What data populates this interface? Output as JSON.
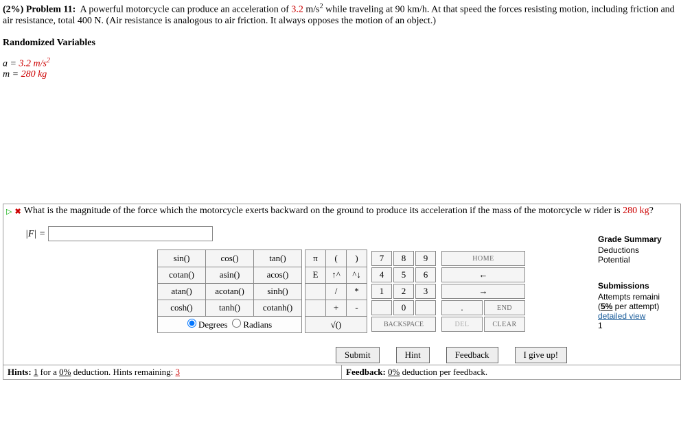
{
  "problem": {
    "weight_label": "(2%) Problem 11:",
    "text_before_a": "A powerful motorcycle can produce an acceleration of ",
    "a_value": "3.2",
    "a_unit": " m/s",
    "text_after_a": " while traveling at 90 km/h. At that speed the forces resisting motion, including friction and air resistance, total 400 N. (Air resistance is analogous to air friction. It always opposes the motion of an object.)"
  },
  "rand_vars": {
    "title": "Randomized Variables",
    "a_label": "a = ",
    "a_value": "3.2 m/s",
    "m_label": "m = ",
    "m_value": "280 kg"
  },
  "question": {
    "text_before": "What is the magnitude of the force which the motorcycle exerts backward on the ground to produce its acceleration if the mass of the motorcycle w rider is ",
    "mass": "280 kg",
    "text_after": "?"
  },
  "answer": {
    "label": "|F| = ",
    "value": ""
  },
  "keypad": {
    "funcs": [
      [
        "sin()",
        "cos()",
        "tan()"
      ],
      [
        "cotan()",
        "asin()",
        "acos()"
      ],
      [
        "atan()",
        "acotan()",
        "sinh()"
      ],
      [
        "cosh()",
        "tanh()",
        "cotanh()"
      ]
    ],
    "col2": [
      [
        "π",
        "(",
        ")"
      ],
      [
        "E",
        "↑^",
        "^↓"
      ],
      [
        "",
        "/",
        "*"
      ],
      [
        "",
        "+",
        "-"
      ]
    ],
    "nums": [
      [
        "7",
        "8",
        "9"
      ],
      [
        "4",
        "5",
        "6"
      ],
      [
        "1",
        "2",
        "3"
      ],
      [
        "",
        "0",
        ""
      ]
    ],
    "ctrl": [
      [
        "HOME"
      ],
      [
        "←"
      ],
      [
        "→"
      ],
      [
        ".",
        "END"
      ]
    ],
    "last": [
      "√()",
      "BACKSPACE",
      "DEL",
      "CLEAR"
    ],
    "mode": {
      "degrees": "Degrees",
      "radians": "Radians"
    }
  },
  "actions": {
    "submit": "Submit",
    "hint": "Hint",
    "feedback": "Feedback",
    "giveup": "I give up!"
  },
  "grade": {
    "title": "Grade Summary",
    "deductions": "Deductions",
    "potential": "Potential",
    "sub_title": "Submissions",
    "attempts": "Attempts remaini",
    "per_attempt_pct": "5%",
    "per_attempt_rest": " per attempt)",
    "detailed": "detailed view",
    "count": "1"
  },
  "footer": {
    "hints_label": "Hints:",
    "hints_count": "1",
    "hints_mid": " for a ",
    "hints_pct": "0%",
    "hints_rest": " deduction. Hints remaining: ",
    "hints_remaining": "3",
    "feedback_label": "Feedback:",
    "feedback_pct": "0%",
    "feedback_rest": " deduction per feedback."
  }
}
